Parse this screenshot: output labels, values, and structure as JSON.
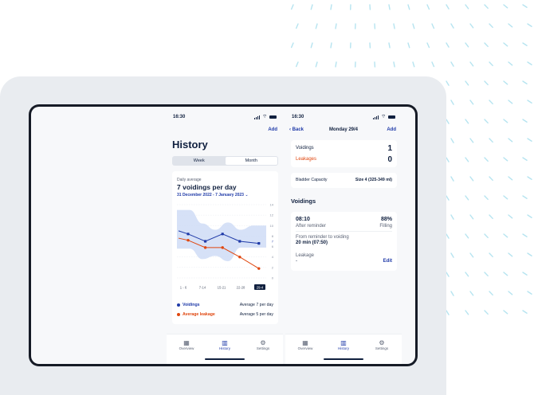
{
  "colors": {
    "accent": "#1f3aa8",
    "leakage": "#e0470f",
    "band": "#cfdcf6",
    "decor_dash": "#b6e4f0"
  },
  "left": {
    "status_time": "16:30",
    "add_label": "Add",
    "title": "History",
    "segments": [
      {
        "label": "Week",
        "active": false
      },
      {
        "label": "Month",
        "active": true
      }
    ],
    "daily_average_label": "Daily average",
    "daily_average_value": "7 voidings per day",
    "date_range": "31 December 2022 - 7 January 2023",
    "chevron_icon": "chevron-down-icon",
    "legend": {
      "voidings_label": "Voidings",
      "voidings_avg": "Average 7 per day",
      "leakage_label": "Average leakage",
      "leakage_avg": "Average 5 per day"
    },
    "tabs": [
      {
        "label": "Overview",
        "icon": "calendar-icon"
      },
      {
        "label": "History",
        "icon": "bar-chart-icon"
      },
      {
        "label": "Settings",
        "icon": "gear-icon"
      }
    ]
  },
  "chart_data": {
    "type": "line",
    "categories": [
      "1 - 6",
      "7-14",
      "15-21",
      "22-28",
      "29-4"
    ],
    "x_index": [
      0,
      1,
      2,
      3,
      4,
      5,
      6
    ],
    "series": [
      {
        "name": "Voidings",
        "values": [
          9,
          8.4,
          7,
          8.4,
          7,
          6.6
        ],
        "x": [
          0,
          0.5,
          1.4,
          2.3,
          3.2,
          4.2
        ]
      },
      {
        "name": "Average leakage",
        "values": [
          7.6,
          7.2,
          5.8,
          5.8,
          4,
          1.8
        ],
        "x": [
          0,
          0.5,
          1.4,
          2.3,
          3.2,
          4.2
        ]
      }
    ],
    "band": {
      "upper": [
        13,
        13,
        10.4,
        9.2,
        10.6,
        9.2,
        10,
        10
      ],
      "lower": [
        5.6,
        5.6,
        3.6,
        4.2,
        3.2,
        5.8,
        5.8,
        5.8
      ]
    },
    "yticks": [
      14,
      12,
      10,
      8,
      7,
      6,
      4,
      2,
      0
    ],
    "ylim": [
      0,
      14
    ],
    "highlight_tick": 7,
    "selected_category": "29-4",
    "grid": true
  },
  "right": {
    "status_time": "16:30",
    "back_label": "Back",
    "title": "Monday 29/4",
    "add_label": "Add",
    "voidings_label": "Voidings",
    "voidings_value": "1",
    "leakages_label": "Leakages",
    "leakages_value": "0",
    "bladder_label": "Bladder Capacity",
    "bladder_value": "Size 4 (325-349 ml)",
    "section_title": "Voidings",
    "entry": {
      "time": "08:10",
      "time_note": "After reminder",
      "filling_value": "88%",
      "filling_label": "Filling",
      "reminder_label": "From reminder to voiding",
      "reminder_value": "20 min (07:50)",
      "leakage_label": "Leakage",
      "leakage_value": "-",
      "edit_label": "Edit"
    },
    "tabs": [
      {
        "label": "Overview",
        "icon": "calendar-icon"
      },
      {
        "label": "History",
        "icon": "bar-chart-icon"
      },
      {
        "label": "Settings",
        "icon": "gear-icon"
      }
    ]
  }
}
